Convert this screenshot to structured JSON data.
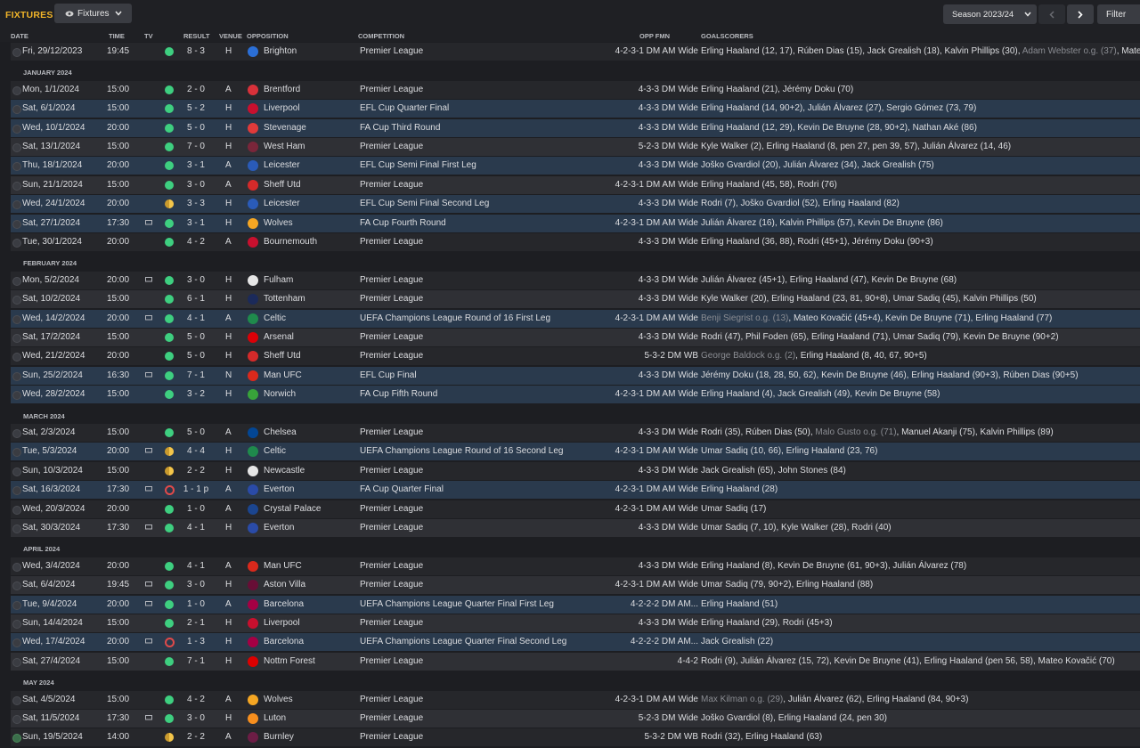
{
  "page": {
    "title": "FIXTURES",
    "view_label": "Fixtures",
    "season_label": "Season 2023/24",
    "filter_label": "Filter"
  },
  "columns": [
    "DATE",
    "TIME",
    "TV",
    "RESULT",
    "VENUE",
    "OPPOSITION",
    "COMPETITION",
    "OPP FMN",
    "GOALSCORERS"
  ],
  "colors": {
    "accent": "#f0b429",
    "win": "#3ecf80",
    "draw": "#f3c54a",
    "loss": "#e04a4a",
    "cup_row": "#2a3a4d"
  },
  "rows": [
    {
      "kind": "match",
      "date": "Fri, 29/12/2023",
      "time": "19:45",
      "tv": false,
      "outcome": "win",
      "result": "8 - 3",
      "venue": "H",
      "opp": "Brighton",
      "crest": "#2b6fd6",
      "comp": "Premier League",
      "fmn": "4-2-3-1 DM AM Wide",
      "cup": false,
      "scorers": [
        {
          "t": "Erling Haaland (12, 17), Rúben Dias (15), Jack Grealish (18), Kalvin Phillips (30), "
        },
        {
          "t": "Adam Webster o.g. (37)",
          "og": true
        },
        {
          "t": ", Mateo..."
        }
      ]
    },
    {
      "kind": "month",
      "label": "JANUARY 2024"
    },
    {
      "kind": "match",
      "date": "Mon, 1/1/2024",
      "time": "15:00",
      "tv": false,
      "outcome": "win",
      "result": "2 - 0",
      "venue": "A",
      "opp": "Brentford",
      "crest": "#d8313a",
      "comp": "Premier League",
      "fmn": "4-3-3 DM Wide",
      "cup": false,
      "scorers": [
        {
          "t": "Erling Haaland (21), Jérémy Doku (70)"
        }
      ]
    },
    {
      "kind": "match",
      "date": "Sat, 6/1/2024",
      "time": "15:00",
      "tv": false,
      "outcome": "win",
      "result": "5 - 2",
      "venue": "H",
      "opp": "Liverpool",
      "crest": "#c8102e",
      "comp": "EFL Cup Quarter Final",
      "fmn": "4-3-3 DM Wide",
      "cup": true,
      "scorers": [
        {
          "t": "Erling Haaland (14, 90+2), Julián Álvarez (27), Sergio Gómez (73, 79)"
        }
      ]
    },
    {
      "kind": "match",
      "date": "Wed, 10/1/2024",
      "time": "20:00",
      "tv": false,
      "outcome": "win",
      "result": "5 - 0",
      "venue": "H",
      "opp": "Stevenage",
      "crest": "#e03a3a",
      "comp": "FA Cup Third Round",
      "fmn": "4-3-3 DM Wide",
      "cup": true,
      "scorers": [
        {
          "t": "Erling Haaland (12, 29), Kevin De Bruyne (28, 90+2), Nathan Aké (86)"
        }
      ]
    },
    {
      "kind": "match",
      "date": "Sat, 13/1/2024",
      "time": "15:00",
      "tv": false,
      "outcome": "win",
      "result": "7 - 0",
      "venue": "H",
      "opp": "West Ham",
      "crest": "#7a263a",
      "comp": "Premier League",
      "fmn": "5-2-3 DM Wide",
      "cup": false,
      "scorers": [
        {
          "t": "Kyle Walker (2), Erling Haaland (8, pen 27, pen 39, 57), Julián Álvarez (14, 46)"
        }
      ]
    },
    {
      "kind": "match",
      "date": "Thu, 18/1/2024",
      "time": "20:00",
      "tv": false,
      "outcome": "win",
      "result": "3 - 1",
      "venue": "A",
      "opp": "Leicester",
      "crest": "#2a5bb8",
      "comp": "EFL Cup Semi Final First Leg",
      "fmn": "4-3-3 DM Wide",
      "cup": true,
      "scorers": [
        {
          "t": "Joško Gvardiol (20), Julián Álvarez (34), Jack Grealish (75)"
        }
      ]
    },
    {
      "kind": "match",
      "date": "Sun, 21/1/2024",
      "time": "15:00",
      "tv": false,
      "outcome": "win",
      "result": "3 - 0",
      "venue": "A",
      "opp": "Sheff Utd",
      "crest": "#d42a2a",
      "comp": "Premier League",
      "fmn": "4-2-3-1 DM AM Wide",
      "cup": false,
      "scorers": [
        {
          "t": "Erling Haaland (45, 58), Rodri (76)"
        }
      ]
    },
    {
      "kind": "match",
      "date": "Wed, 24/1/2024",
      "time": "20:00",
      "tv": false,
      "outcome": "draw",
      "result": "3 - 3",
      "venue": "H",
      "opp": "Leicester",
      "crest": "#2a5bb8",
      "comp": "EFL Cup Semi Final Second Leg",
      "fmn": "4-3-3 DM Wide",
      "cup": true,
      "scorers": [
        {
          "t": "Rodri (7), Joško Gvardiol (52), Erling Haaland (82)"
        }
      ]
    },
    {
      "kind": "match",
      "date": "Sat, 27/1/2024",
      "time": "17:30",
      "tv": true,
      "outcome": "win",
      "result": "3 - 1",
      "venue": "H",
      "opp": "Wolves",
      "crest": "#f5a623",
      "comp": "FA Cup Fourth Round",
      "fmn": "4-2-3-1 DM AM Wide",
      "cup": true,
      "scorers": [
        {
          "t": "Julián Álvarez (16), Kalvin Phillips (57), Kevin De Bruyne (86)"
        }
      ]
    },
    {
      "kind": "match",
      "date": "Tue, 30/1/2024",
      "time": "20:00",
      "tv": false,
      "outcome": "win",
      "result": "4 - 2",
      "venue": "A",
      "opp": "Bournemouth",
      "crest": "#c8102e",
      "comp": "Premier League",
      "fmn": "4-3-3 DM Wide",
      "cup": false,
      "scorers": [
        {
          "t": "Erling Haaland (36, 88), Rodri (45+1), Jérémy Doku (90+3)"
        }
      ]
    },
    {
      "kind": "month",
      "label": "FEBRUARY 2024"
    },
    {
      "kind": "match",
      "date": "Mon, 5/2/2024",
      "time": "20:00",
      "tv": true,
      "outcome": "win",
      "result": "3 - 0",
      "venue": "H",
      "opp": "Fulham",
      "crest": "#e6e6e6",
      "comp": "Premier League",
      "fmn": "4-3-3 DM Wide",
      "cup": false,
      "scorers": [
        {
          "t": "Julián Álvarez (45+1), Erling Haaland (47), Kevin De Bruyne (68)"
        }
      ]
    },
    {
      "kind": "match",
      "date": "Sat, 10/2/2024",
      "time": "15:00",
      "tv": false,
      "outcome": "win",
      "result": "6 - 1",
      "venue": "H",
      "opp": "Tottenham",
      "crest": "#1b2a5a",
      "comp": "Premier League",
      "fmn": "4-3-3 DM Wide",
      "cup": false,
      "scorers": [
        {
          "t": "Kyle Walker (20), Erling Haaland (23, 81, 90+8), Umar Sadiq (45), Kalvin Phillips (50)"
        }
      ]
    },
    {
      "kind": "match",
      "date": "Wed, 14/2/2024",
      "time": "20:00",
      "tv": true,
      "outcome": "win",
      "result": "4 - 1",
      "venue": "A",
      "opp": "Celtic",
      "crest": "#1f8a4c",
      "comp": "UEFA Champions League Round of 16 First Leg",
      "fmn": "4-2-3-1 DM AM Wide",
      "cup": true,
      "scorers": [
        {
          "t": "Benji Siegrist o.g. (13)",
          "og": true
        },
        {
          "t": ", Mateo Kovačić (45+4), Kevin De Bruyne (71), Erling Haaland (77)"
        }
      ]
    },
    {
      "kind": "match",
      "date": "Sat, 17/2/2024",
      "time": "15:00",
      "tv": false,
      "outcome": "win",
      "result": "5 - 0",
      "venue": "H",
      "opp": "Arsenal",
      "crest": "#db0007",
      "comp": "Premier League",
      "fmn": "4-3-3 DM Wide",
      "cup": false,
      "scorers": [
        {
          "t": "Rodri (47), Phil Foden (65), Erling Haaland (71), Umar Sadiq (79), Kevin De Bruyne (90+2)"
        }
      ]
    },
    {
      "kind": "match",
      "date": "Wed, 21/2/2024",
      "time": "20:00",
      "tv": false,
      "outcome": "win",
      "result": "5 - 0",
      "venue": "H",
      "opp": "Sheff Utd",
      "crest": "#d42a2a",
      "comp": "Premier League",
      "fmn": "5-3-2 DM WB",
      "cup": false,
      "scorers": [
        {
          "t": "George Baldock o.g. (2)",
          "og": true
        },
        {
          "t": ", Erling Haaland (8, 40, 67, 90+5)"
        }
      ]
    },
    {
      "kind": "match",
      "date": "Sun, 25/2/2024",
      "time": "16:30",
      "tv": true,
      "outcome": "win",
      "result": "7 - 1",
      "venue": "N",
      "opp": "Man UFC",
      "crest": "#da291c",
      "comp": "EFL Cup Final",
      "fmn": "4-3-3 DM Wide",
      "cup": true,
      "scorers": [
        {
          "t": "Jérémy Doku (18, 28, 50, 62), Kevin De Bruyne (46), Erling Haaland (90+3), Rúben Dias (90+5)"
        }
      ]
    },
    {
      "kind": "match",
      "date": "Wed, 28/2/2024",
      "time": "15:00",
      "tv": false,
      "outcome": "win",
      "result": "3 - 2",
      "venue": "H",
      "opp": "Norwich",
      "crest": "#38a33a",
      "comp": "FA Cup Fifth Round",
      "fmn": "4-2-3-1 DM AM Wide",
      "cup": true,
      "scorers": [
        {
          "t": "Erling Haaland (4), Jack Grealish (49), Kevin De Bruyne (58)"
        }
      ]
    },
    {
      "kind": "month",
      "label": "MARCH 2024"
    },
    {
      "kind": "match",
      "date": "Sat, 2/3/2024",
      "time": "15:00",
      "tv": false,
      "outcome": "win",
      "result": "5 - 0",
      "venue": "A",
      "opp": "Chelsea",
      "crest": "#034694",
      "comp": "Premier League",
      "fmn": "4-3-3 DM Wide",
      "cup": false,
      "scorers": [
        {
          "t": "Rodri (35), Rúben Dias (50), "
        },
        {
          "t": "Malo Gusto o.g. (71)",
          "og": true
        },
        {
          "t": ", Manuel Akanji (75), Kalvin Phillips (89)"
        }
      ]
    },
    {
      "kind": "match",
      "date": "Tue, 5/3/2024",
      "time": "20:00",
      "tv": true,
      "outcome": "draw",
      "result": "4 - 4",
      "venue": "H",
      "opp": "Celtic",
      "crest": "#1f8a4c",
      "comp": "UEFA Champions League Round of 16 Second Leg",
      "fmn": "4-2-3-1 DM AM Wide",
      "cup": true,
      "scorers": [
        {
          "t": "Umar Sadiq (10, 66), Erling Haaland (23, 76)"
        }
      ]
    },
    {
      "kind": "match",
      "date": "Sun, 10/3/2024",
      "time": "15:00",
      "tv": false,
      "outcome": "draw",
      "result": "2 - 2",
      "venue": "H",
      "opp": "Newcastle",
      "crest": "#e6e6e6",
      "comp": "Premier League",
      "fmn": "4-3-3 DM Wide",
      "cup": false,
      "scorers": [
        {
          "t": "Jack Grealish (65), John Stones (84)"
        }
      ]
    },
    {
      "kind": "match",
      "date": "Sat, 16/3/2024",
      "time": "17:30",
      "tv": true,
      "outcome": "loss",
      "result": "1 - 1 p",
      "venue": "A",
      "opp": "Everton",
      "crest": "#2a4ba8",
      "comp": "FA Cup Quarter Final",
      "fmn": "4-2-3-1 DM AM Wide",
      "cup": true,
      "scorers": [
        {
          "t": "Erling Haaland (28)"
        }
      ]
    },
    {
      "kind": "match",
      "date": "Wed, 20/3/2024",
      "time": "20:00",
      "tv": false,
      "outcome": "win",
      "result": "1 - 0",
      "venue": "A",
      "opp": "Crystal Palace",
      "crest": "#1b458f",
      "comp": "Premier League",
      "fmn": "4-2-3-1 DM AM Wide",
      "cup": false,
      "scorers": [
        {
          "t": "Umar Sadiq (17)"
        }
      ]
    },
    {
      "kind": "match",
      "date": "Sat, 30/3/2024",
      "time": "17:30",
      "tv": true,
      "outcome": "win",
      "result": "4 - 1",
      "venue": "H",
      "opp": "Everton",
      "crest": "#2a4ba8",
      "comp": "Premier League",
      "fmn": "4-3-3 DM Wide",
      "cup": false,
      "scorers": [
        {
          "t": "Umar Sadiq (7, 10), Kyle Walker (28), Rodri (40)"
        }
      ]
    },
    {
      "kind": "month",
      "label": "APRIL 2024"
    },
    {
      "kind": "match",
      "date": "Wed, 3/4/2024",
      "time": "20:00",
      "tv": false,
      "outcome": "win",
      "result": "4 - 1",
      "venue": "A",
      "opp": "Man UFC",
      "crest": "#da291c",
      "comp": "Premier League",
      "fmn": "4-3-3 DM Wide",
      "cup": false,
      "scorers": [
        {
          "t": "Erling Haaland (8), Kevin De Bruyne (61, 90+3), Julián Álvarez (78)"
        }
      ]
    },
    {
      "kind": "match",
      "date": "Sat, 6/4/2024",
      "time": "19:45",
      "tv": true,
      "outcome": "win",
      "result": "3 - 0",
      "venue": "H",
      "opp": "Aston Villa",
      "crest": "#670e36",
      "comp": "Premier League",
      "fmn": "4-2-3-1 DM AM Wide",
      "cup": false,
      "scorers": [
        {
          "t": "Umar Sadiq (79, 90+2), Erling Haaland (88)"
        }
      ]
    },
    {
      "kind": "match",
      "date": "Tue, 9/4/2024",
      "time": "20:00",
      "tv": true,
      "outcome": "win",
      "result": "1 - 0",
      "venue": "A",
      "opp": "Barcelona",
      "crest": "#a50044",
      "comp": "UEFA Champions League Quarter Final First Leg",
      "fmn": "4-2-2-2 DM AM...",
      "cup": true,
      "scorers": [
        {
          "t": "Erling Haaland (51)"
        }
      ]
    },
    {
      "kind": "match",
      "date": "Sun, 14/4/2024",
      "time": "15:00",
      "tv": false,
      "outcome": "win",
      "result": "2 - 1",
      "venue": "H",
      "opp": "Liverpool",
      "crest": "#c8102e",
      "comp": "Premier League",
      "fmn": "4-3-3 DM Wide",
      "cup": false,
      "scorers": [
        {
          "t": "Erling Haaland (29), Rodri (45+3)"
        }
      ]
    },
    {
      "kind": "match",
      "date": "Wed, 17/4/2024",
      "time": "20:00",
      "tv": true,
      "outcome": "loss",
      "result": "1 - 3",
      "venue": "H",
      "opp": "Barcelona",
      "crest": "#a50044",
      "comp": "UEFA Champions League Quarter Final Second Leg",
      "fmn": "4-2-2-2 DM AM...",
      "cup": true,
      "scorers": [
        {
          "t": "Jack Grealish (22)"
        }
      ]
    },
    {
      "kind": "match",
      "date": "Sat, 27/4/2024",
      "time": "15:00",
      "tv": false,
      "outcome": "win",
      "result": "7 - 1",
      "venue": "H",
      "opp": "Nottm Forest",
      "crest": "#dd0000",
      "comp": "Premier League",
      "fmn": "4-4-2",
      "cup": false,
      "scorers": [
        {
          "t": "Rodri (9), Julián Álvarez (15, 72), Kevin De Bruyne (41), Erling Haaland (pen 56, 58), Mateo Kovačić (70)"
        }
      ]
    },
    {
      "kind": "month",
      "label": "MAY 2024"
    },
    {
      "kind": "match",
      "date": "Sat, 4/5/2024",
      "time": "15:00",
      "tv": false,
      "outcome": "win",
      "result": "4 - 2",
      "venue": "A",
      "opp": "Wolves",
      "crest": "#f5a623",
      "comp": "Premier League",
      "fmn": "4-2-3-1 DM AM Wide",
      "cup": false,
      "scorers": [
        {
          "t": "Max Kilman o.g. (29)",
          "og": true
        },
        {
          "t": ", Julián Álvarez (62), Erling Haaland (84, 90+3)"
        }
      ]
    },
    {
      "kind": "match",
      "date": "Sat, 11/5/2024",
      "time": "17:30",
      "tv": true,
      "outcome": "win",
      "result": "3 - 0",
      "venue": "H",
      "opp": "Luton",
      "crest": "#f78f1e",
      "comp": "Premier League",
      "fmn": "5-2-3 DM Wide",
      "cup": false,
      "scorers": [
        {
          "t": "Joško Gvardiol (8), Erling Haaland (24, pen 30)"
        }
      ]
    },
    {
      "kind": "match",
      "date": "Sun, 19/5/2024",
      "time": "14:00",
      "tv": false,
      "outcome": "draw",
      "result": "2 - 2",
      "venue": "A",
      "opp": "Burnley",
      "crest": "#6c1d45",
      "comp": "Premier League",
      "fmn": "5-3-2 DM WB",
      "cup": false,
      "checked": true,
      "scorers": [
        {
          "t": "Rodri (32), Erling Haaland (63)"
        }
      ]
    }
  ]
}
